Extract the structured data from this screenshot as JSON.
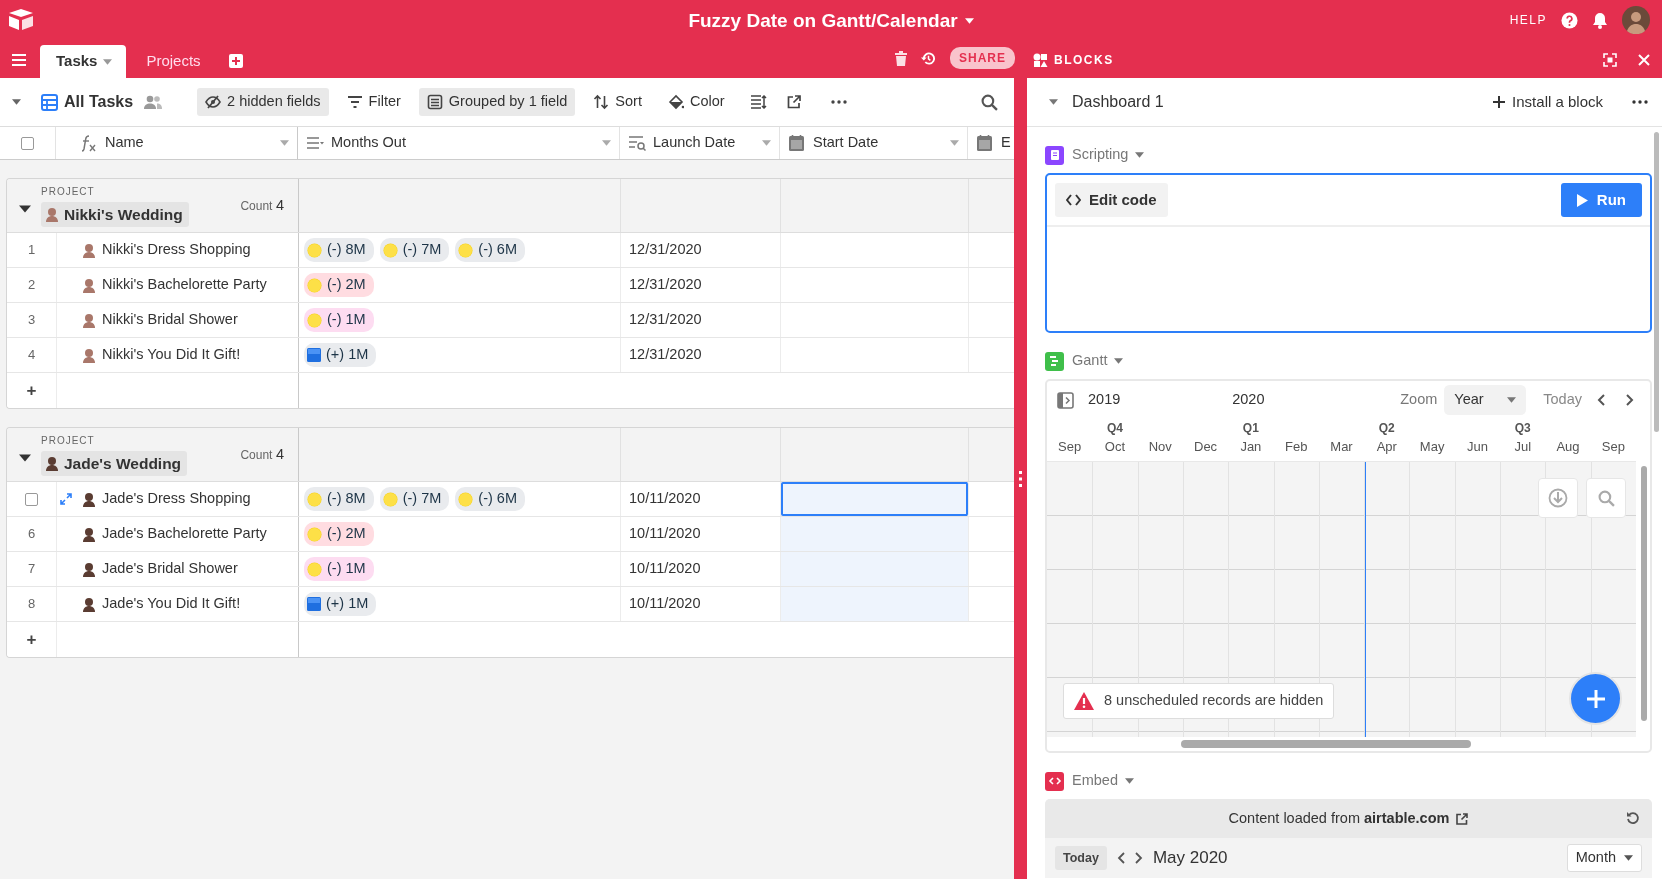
{
  "header": {
    "title": "Fuzzy Date on Gantt/Calendar",
    "help": "HELP"
  },
  "tabs": [
    {
      "label": "Tasks",
      "selected": true
    },
    {
      "label": "Projects",
      "selected": false
    }
  ],
  "base_actions": {
    "share": "SHARE",
    "blocks": "BLOCKS"
  },
  "view": {
    "name": "All Tasks",
    "tools": [
      {
        "label": "2 hidden fields",
        "kind": "hide",
        "active": true
      },
      {
        "label": "Filter",
        "kind": "filter",
        "active": false
      },
      {
        "label": "Grouped by 1 field",
        "kind": "group",
        "active": true
      },
      {
        "label": "Sort",
        "kind": "sort",
        "active": false
      },
      {
        "label": "Color",
        "kind": "color",
        "active": false
      }
    ]
  },
  "select_all_checked": false,
  "columns": [
    {
      "label": "Name",
      "kind": "formula"
    },
    {
      "label": "Months Out",
      "kind": "select"
    },
    {
      "label": "Launch Date",
      "kind": "lookup"
    },
    {
      "label": "Start Date",
      "kind": "date"
    },
    {
      "label": "E",
      "kind": "date"
    }
  ],
  "groups": [
    {
      "caption": "PROJECT",
      "name": "Nikki's Wedding",
      "count_label": "Count",
      "count": "4",
      "add": "+",
      "rows": [
        {
          "number": "1",
          "hovered": false,
          "name": "Nikki's Dress Shopping",
          "months": [
            {
              "label": "(-) 8M",
              "kind": "circle",
              "color": "#e9ebee"
            },
            {
              "label": "(-) 7M",
              "kind": "circle",
              "color": "#e9ebee"
            },
            {
              "label": "(-) 6M",
              "kind": "circle",
              "color": "#e9ebee"
            }
          ],
          "launch": "12/31/2020",
          "start_selected": false,
          "start_highlighted": false
        },
        {
          "number": "2",
          "hovered": false,
          "name": "Nikki's Bachelorette Party",
          "months": [
            {
              "label": "(-) 2M",
              "kind": "circle",
              "color": "#ffdce1"
            }
          ],
          "launch": "12/31/2020",
          "start_selected": false,
          "start_highlighted": false
        },
        {
          "number": "3",
          "hovered": false,
          "name": "Nikki's Bridal Shower",
          "months": [
            {
              "label": "(-) 1M",
              "kind": "circle",
              "color": "#fddcf1"
            }
          ],
          "launch": "12/31/2020",
          "start_selected": false,
          "start_highlighted": false
        },
        {
          "number": "4",
          "hovered": false,
          "name": "Nikki's You Did It Gift!",
          "months": [
            {
              "label": "(+) 1M",
              "kind": "square",
              "color": "#e9ebee"
            }
          ],
          "launch": "12/31/2020",
          "start_selected": false,
          "start_highlighted": false
        }
      ]
    },
    {
      "caption": "PROJECT",
      "name": "Jade's Wedding",
      "count_label": "Count",
      "count": "4",
      "add": "+",
      "rows": [
        {
          "hovered": true,
          "checked": false,
          "name": "Jade's Dress Shopping",
          "months": [
            {
              "label": "(-) 8M",
              "kind": "circle",
              "color": "#e9ebee"
            },
            {
              "label": "(-) 7M",
              "kind": "circle",
              "color": "#e9ebee"
            },
            {
              "label": "(-) 6M",
              "kind": "circle",
              "color": "#e9ebee"
            }
          ],
          "launch": "10/11/2020",
          "start_selected": true,
          "start_highlighted": true
        },
        {
          "number": "6",
          "hovered": false,
          "name": "Jade's Bachelorette Party",
          "months": [
            {
              "label": "(-) 2M",
              "kind": "circle",
              "color": "#ffdce1"
            }
          ],
          "launch": "10/11/2020",
          "start_selected": false,
          "start_highlighted": true
        },
        {
          "number": "7",
          "hovered": false,
          "name": "Jade's Bridal Shower",
          "months": [
            {
              "label": "(-) 1M",
              "kind": "circle",
              "color": "#fddcf1"
            }
          ],
          "launch": "10/11/2020",
          "start_selected": false,
          "start_highlighted": true
        },
        {
          "number": "8",
          "hovered": false,
          "name": "Jade's You Did It Gift!",
          "months": [
            {
              "label": "(+) 1M",
              "kind": "square",
              "color": "#e9ebee"
            }
          ],
          "launch": "10/11/2020",
          "start_selected": false,
          "start_highlighted": true
        }
      ]
    }
  ],
  "dashboard": {
    "title": "Dashboard 1",
    "install": "Install a block"
  },
  "blocks": [
    {
      "kind": "scripting",
      "name": "Scripting",
      "edit": "Edit code",
      "run": "Run"
    },
    {
      "kind": "gantt",
      "name": "Gantt",
      "zoom_label": "Zoom",
      "zoom_value": "Year",
      "today": "Today",
      "notice": "8 unscheduled records are hidden",
      "months": [
        {
          "label": "Sep",
          "year": "2019",
          "today": false
        },
        {
          "label": "Oct",
          "quarter": "Q4",
          "today": false
        },
        {
          "label": "Nov",
          "today": false
        },
        {
          "label": "Dec",
          "today": false
        },
        {
          "label": "Jan",
          "quarter": "Q1",
          "year": "2020",
          "today": false
        },
        {
          "label": "Feb",
          "today": false
        },
        {
          "label": "Mar",
          "today": true
        },
        {
          "label": "Apr",
          "quarter": "Q2",
          "today": false
        },
        {
          "label": "May",
          "today": false
        },
        {
          "label": "Jun",
          "today": false
        },
        {
          "label": "Jul",
          "quarter": "Q3",
          "today": false
        },
        {
          "label": "Aug",
          "today": false
        },
        {
          "label": "Sep",
          "today": false
        }
      ]
    },
    {
      "kind": "embed",
      "name": "Embed",
      "source": "Content loaded from **airtable.com**",
      "today": "Today",
      "period": "May 2020",
      "view": "Month"
    }
  ]
}
